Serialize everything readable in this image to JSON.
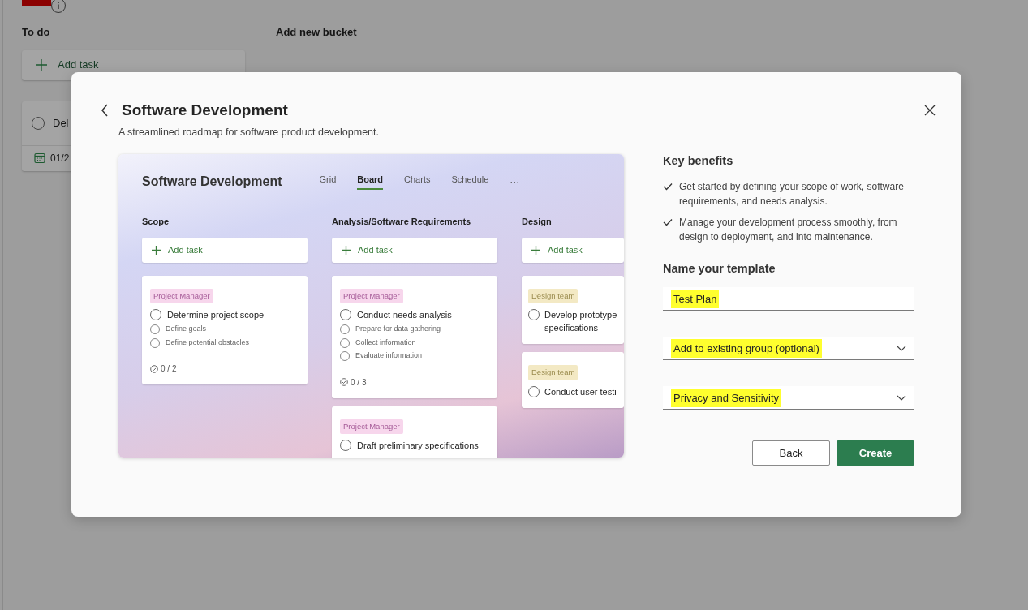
{
  "background": {
    "columns": [
      {
        "title": "To do"
      },
      {
        "title": "Add new bucket"
      }
    ],
    "add_task": "Add task",
    "task": {
      "title": "Del",
      "checked": false,
      "date": "01/2"
    }
  },
  "dialog": {
    "title": "Software Development",
    "subtitle": "A streamlined roadmap for software product development.",
    "preview": {
      "title": "Software Development",
      "tabs": [
        {
          "label": "Grid",
          "selected": false
        },
        {
          "label": "Board",
          "selected": true
        },
        {
          "label": "Charts",
          "selected": false
        },
        {
          "label": "Schedule",
          "selected": false
        }
      ],
      "more": "···",
      "buckets": [
        {
          "title": "Scope",
          "add_label": "Add task",
          "cards": [
            {
              "tag": "Project Manager",
              "color": "#f7d6ec",
              "task": "Determine project scope",
              "checked": false,
              "subtasks": [
                {
                  "title": "Define goals",
                  "checked": false
                },
                {
                  "title": "Define potential obstacles",
                  "checked": false
                }
              ],
              "progress": "0 / 2"
            }
          ]
        },
        {
          "title": "Analysis/Software Requirements",
          "add_label": "Add task",
          "cards": [
            {
              "tag": "Project Manager",
              "color": "#f7d6ec",
              "task": "Conduct needs analysis",
              "checked": false,
              "subtasks": [
                {
                  "title": "Prepare for data gathering",
                  "checked": false
                },
                {
                  "title": "Collect information",
                  "checked": false
                },
                {
                  "title": "Evaluate information",
                  "checked": false
                }
              ],
              "progress": "0 / 3"
            },
            {
              "tag": "Project Manager",
              "color": "#f7d6ec",
              "task": "Draft preliminary specifications",
              "checked": false
            }
          ]
        },
        {
          "title": "Design",
          "add_label": "Add task",
          "cards": [
            {
              "tag": "Design team",
              "color": "#f3e9c4",
              "task": "Develop prototype specifications",
              "checked": false
            },
            {
              "tag": "Design team",
              "color": "#f3e9c4",
              "task": "Conduct user testi",
              "checked": false
            }
          ]
        }
      ]
    },
    "benefits_title": "Key benefits",
    "benefits": [
      "Get started by defining your scope of work, software requirements, and needs analysis.",
      "Manage your development process smoothly, from design to deployment, and into maintenance."
    ],
    "name_title": "Name your template",
    "fields": [
      {
        "kind": "text",
        "value": "Test Plan",
        "highlighted": true
      },
      {
        "kind": "select",
        "value": "Add to existing group (optional)",
        "highlighted": true
      },
      {
        "kind": "select",
        "value": "Privacy and Sensitivity",
        "highlighted": true
      }
    ],
    "buttons": [
      {
        "label": "Back",
        "kind": "secondary"
      },
      {
        "label": "Create",
        "kind": "primary"
      }
    ]
  }
}
